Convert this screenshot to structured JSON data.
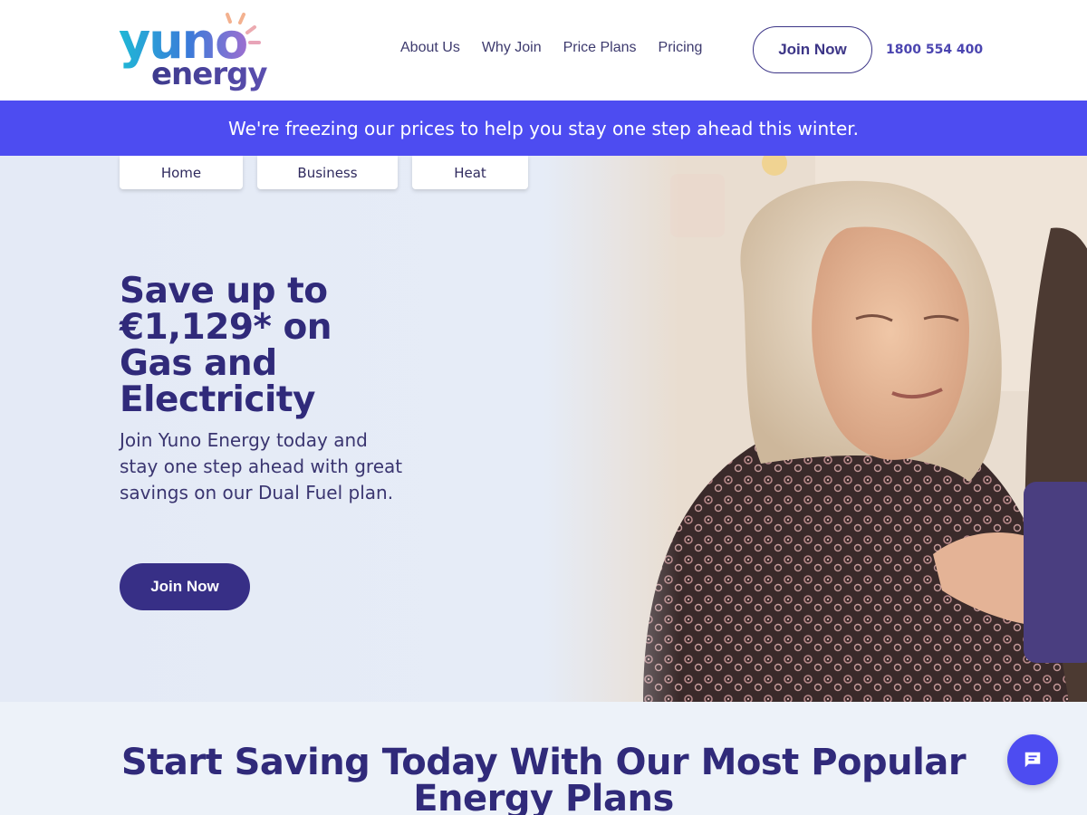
{
  "header": {
    "logo_top": "yuno",
    "logo_bottom": "energy",
    "nav": [
      "About Us",
      "Why Join",
      "Price Plans",
      "Pricing"
    ],
    "join_label": "Join Now",
    "phone": "1800 554 400"
  },
  "banner": {
    "text": "We're freezing our prices to help you stay one step ahead this winter."
  },
  "hero": {
    "tabs": [
      "Home",
      "Business",
      "Heat"
    ],
    "title": "Save up to €1,129* on Gas and Electricity",
    "subtitle": "Join Yuno Energy today and stay one step ahead with great savings on our Dual Fuel plan.",
    "cta_label": "Join Now"
  },
  "section": {
    "title": "Start Saving Today With Our Most Popular Energy Plans"
  },
  "icons": {
    "chat": "chat-bubble-icon",
    "logo_sun": "sun-icon"
  },
  "colors": {
    "brand_primary": "#372f86",
    "banner": "#4d4cf1",
    "heading": "#302a7a"
  }
}
